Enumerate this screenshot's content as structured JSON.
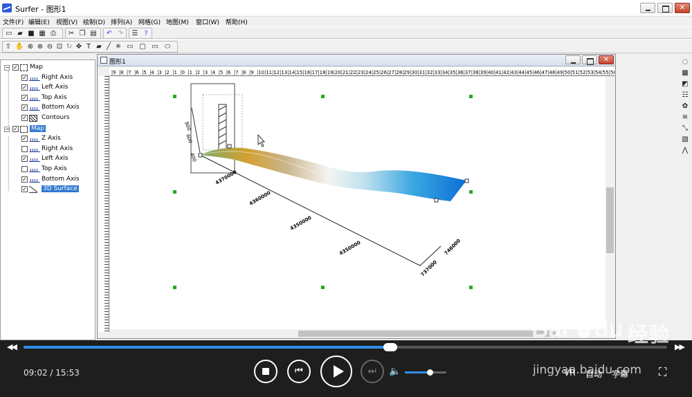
{
  "window": {
    "title": "Surfer - 图形1"
  },
  "menu": [
    "文件(F)",
    "编辑(E)",
    "视图(V)",
    "绘制(D)",
    "排列(A)",
    "网格(G)",
    "地图(M)",
    "窗口(W)",
    "帮助(H)"
  ],
  "object_manager": {
    "items": [
      {
        "label": "Map",
        "checked": true,
        "level": 0,
        "icon": "map-frame-icon",
        "selected": false
      },
      {
        "label": "Right Axis",
        "checked": true,
        "level": 1,
        "icon": "axis-icon",
        "selected": false
      },
      {
        "label": "Left Axis",
        "checked": true,
        "level": 1,
        "icon": "axis-icon",
        "selected": false
      },
      {
        "label": "Top Axis",
        "checked": true,
        "level": 1,
        "icon": "axis-icon",
        "selected": false
      },
      {
        "label": "Bottom Axis",
        "checked": true,
        "level": 1,
        "icon": "axis-icon",
        "selected": false
      },
      {
        "label": "Contours",
        "checked": true,
        "level": 1,
        "icon": "contour-icon",
        "selected": false
      },
      {
        "label": "Map",
        "checked": true,
        "level": 0,
        "icon": "map-frame-icon",
        "selected": true
      },
      {
        "label": "Z Axis",
        "checked": true,
        "level": 1,
        "icon": "axis-icon",
        "selected": false
      },
      {
        "label": "Right Axis",
        "checked": false,
        "level": 1,
        "icon": "axis-icon",
        "selected": false
      },
      {
        "label": "Left Axis",
        "checked": true,
        "level": 1,
        "icon": "axis-icon",
        "selected": false
      },
      {
        "label": "Top Axis",
        "checked": false,
        "level": 1,
        "icon": "axis-icon",
        "selected": false
      },
      {
        "label": "Bottom Axis",
        "checked": true,
        "level": 1,
        "icon": "axis-icon",
        "selected": false
      },
      {
        "label": "3D Surface",
        "checked": true,
        "level": 1,
        "icon": "surface-icon",
        "selected": true
      }
    ]
  },
  "document": {
    "title": "图形1",
    "ruler_top_labels": [
      "9",
      "8",
      "7",
      "6",
      "5",
      "4",
      "3",
      "2",
      "1",
      "0",
      "1",
      "2",
      "3",
      "4",
      "5",
      "6",
      "7",
      "8",
      "9",
      "10",
      "11",
      "12",
      "13",
      "14",
      "15",
      "16",
      "17",
      "18",
      "19",
      "20",
      "21",
      "22",
      "23",
      "24",
      "25",
      "26",
      "27",
      "28",
      "29",
      "30",
      "31",
      "32",
      "33",
      "34",
      "35",
      "36",
      "37",
      "38",
      "39",
      "40",
      "41",
      "42",
      "43",
      "44",
      "45",
      "46",
      "47",
      "48",
      "49",
      "50",
      "51",
      "52",
      "53",
      "54",
      "55",
      "56"
    ],
    "axis_labels": [
      "4370000",
      "4360000",
      "4350000",
      "4350000",
      "737000",
      "746000"
    ]
  },
  "player": {
    "current_time": "09:02",
    "total_time": "15:53",
    "progress_fraction": 0.57,
    "volume_fraction": 0.6,
    "labels": [
      "VR",
      "自动",
      "字幕"
    ]
  },
  "watermark": {
    "brand": "Bai",
    "brand_suffix": "du",
    "product": "经验",
    "url": "jingyan.baidu.com"
  },
  "colors": {
    "accent": "#2f8fe8",
    "selection": "#3178d0",
    "handle": "#22aa22"
  }
}
